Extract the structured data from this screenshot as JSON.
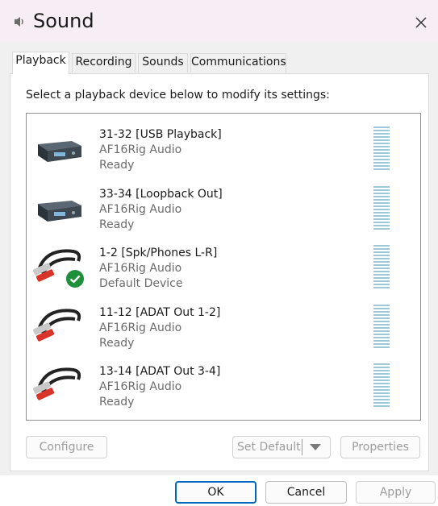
{
  "window": {
    "title": "Sound",
    "close_icon": "close-icon",
    "title_icon": "speaker-icon"
  },
  "tabs": [
    {
      "label": "Playback",
      "active": true
    },
    {
      "label": "Recording",
      "active": false
    },
    {
      "label": "Sounds",
      "active": false
    },
    {
      "label": "Communications",
      "active": false
    }
  ],
  "instruction": "Select a playback device below to modify its settings:",
  "devices": [
    {
      "name": "31-32 [USB Playback]",
      "description": "AF16Rig Audio",
      "status": "Ready",
      "icon": "usb-audio-device-icon",
      "is_default": false
    },
    {
      "name": "33-34 [Loopback Out]",
      "description": "AF16Rig Audio",
      "status": "Ready",
      "icon": "usb-audio-device-icon",
      "is_default": false
    },
    {
      "name": "1-2 [Spk/Phones L-R]",
      "description": "AF16Rig Audio",
      "status": "Default Device",
      "icon": "rca-cable-icon",
      "is_default": true
    },
    {
      "name": "11-12 [ADAT Out 1-2]",
      "description": "AF16Rig Audio",
      "status": "Ready",
      "icon": "rca-cable-icon",
      "is_default": false
    },
    {
      "name": "13-14 [ADAT Out 3-4]",
      "description": "AF16Rig Audio",
      "status": "Ready",
      "icon": "rca-cable-icon",
      "is_default": false
    }
  ],
  "buttons": {
    "configure": "Configure",
    "set_default": "Set Default",
    "properties": "Properties",
    "ok": "OK",
    "cancel": "Cancel",
    "apply": "Apply"
  },
  "colors": {
    "accent": "#0067c0",
    "default_check": "#1e8f3b",
    "meter": "#9fc7dc",
    "titlebar": "#f6eef4"
  }
}
